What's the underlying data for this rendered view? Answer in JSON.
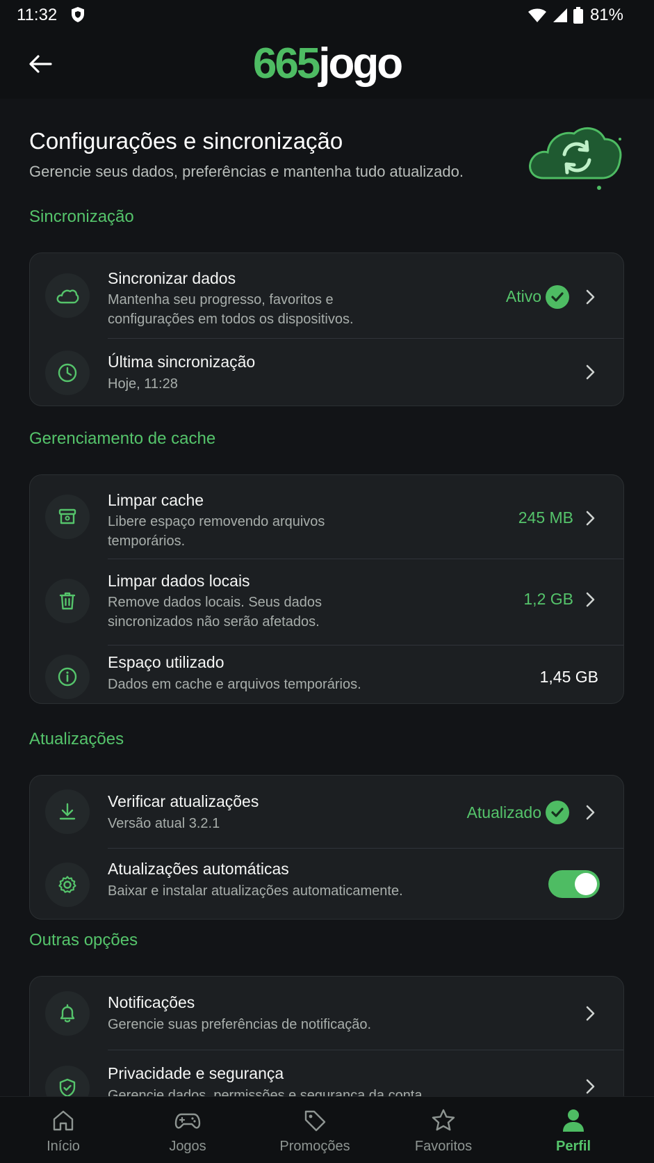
{
  "status_bar": {
    "time": "11:32",
    "battery": "81%"
  },
  "header": {
    "logo_number": "665",
    "logo_word": "jogo"
  },
  "page": {
    "title": "Configurações e sincronização",
    "subtitle": "Gerencie seus dados, preferências e mantenha tudo atualizado."
  },
  "sections": {
    "sync": {
      "title": "Sincronização",
      "sync_data": {
        "title": "Sincronizar dados",
        "desc": "Mantenha seu progresso, favoritos e configurações em todos os dispositivos.",
        "status": "Ativo"
      },
      "last_sync": {
        "title": "Última sincronização",
        "desc": "Hoje, 11:28"
      }
    },
    "cache": {
      "title": "Gerenciamento de cache",
      "clear_cache": {
        "title": "Limpar cache",
        "desc": "Libere espaço removendo arquivos temporários.",
        "value": "245 MB"
      },
      "clear_local": {
        "title": "Limpar dados locais",
        "desc": "Remove dados locais. Seus dados sincronizados não serão afetados.",
        "value": "1,2 GB"
      },
      "space_used": {
        "title": "Espaço utilizado",
        "desc": "Dados em cache e arquivos temporários.",
        "value": "1,45 GB"
      }
    },
    "updates": {
      "title": "Atualizações",
      "check": {
        "title": "Verificar atualizações",
        "desc": "Versão atual 3.2.1",
        "status": "Atualizado"
      },
      "auto": {
        "title": "Atualizações automáticas",
        "desc": "Baixar e instalar atualizações automaticamente.",
        "enabled": true
      }
    },
    "other": {
      "title": "Outras opções",
      "notifications": {
        "title": "Notificações",
        "desc": "Gerencie suas preferências de notificação."
      },
      "privacy": {
        "title": "Privacidade e segurança",
        "desc": "Gerencie dados, permissões e segurança da conta."
      }
    }
  },
  "nav": {
    "items": [
      {
        "label": "Início",
        "icon": "home-icon"
      },
      {
        "label": "Jogos",
        "icon": "gamepad-icon"
      },
      {
        "label": "Promoções",
        "icon": "tag-icon"
      },
      {
        "label": "Favoritos",
        "icon": "star-icon"
      },
      {
        "label": "Perfil",
        "icon": "user-icon"
      }
    ],
    "active": "Perfil"
  },
  "colors": {
    "accent": "#4ebc63",
    "background": "#121417",
    "card": "#1c1f22"
  }
}
